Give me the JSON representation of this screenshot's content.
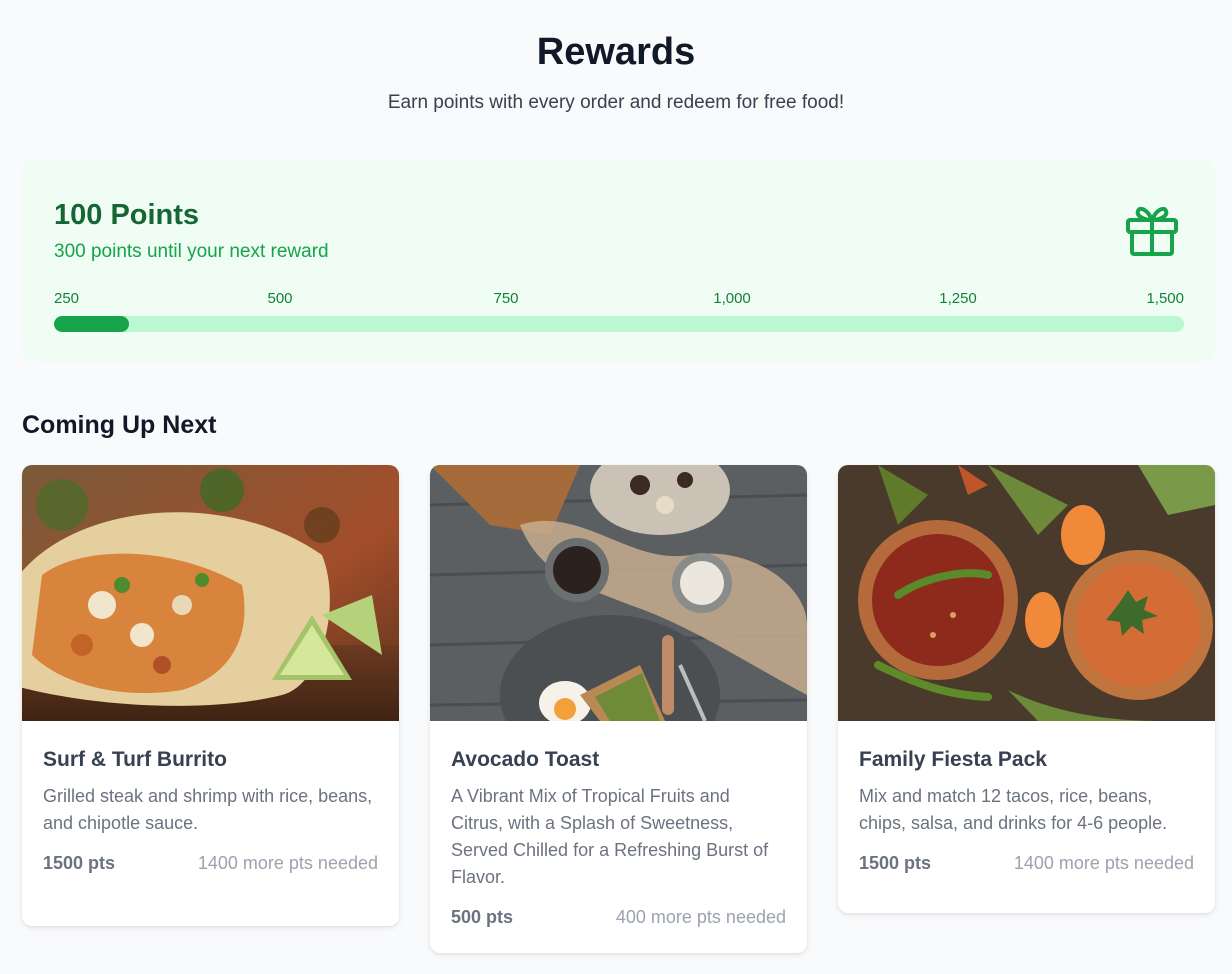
{
  "header": {
    "title": "Rewards",
    "subtitle": "Earn points with every order and redeem for free food!"
  },
  "points_card": {
    "points_label": "100 Points",
    "next_reward_text": "300 points until your next reward",
    "icon": "gift-icon",
    "progress_ticks": [
      "250",
      "500",
      "750",
      "1,000",
      "1,250",
      "1,500"
    ],
    "progress_fraction": 0.066
  },
  "section": {
    "title": "Coming Up Next"
  },
  "rewards": [
    {
      "title": "Surf & Turf Burrito",
      "description": "Grilled steak and shrimp with rice, beans, and chipotle sauce.",
      "points": "1500 pts",
      "needed": "1400 more pts needed",
      "image": "burrito-photo"
    },
    {
      "title": "Avocado Toast",
      "description": "A Vibrant Mix of Tropical Fruits and Citrus, with a Splash of Sweetness, Served Chilled for a Refreshing Burst of Flavor.",
      "points": "500 pts",
      "needed": "400 more pts needed",
      "image": "avocado-toast-photo"
    },
    {
      "title": "Family Fiesta Pack",
      "description": "Mix and match 12 tacos, rice, beans, chips, salsa, and drinks for 4-6 people.",
      "points": "1500 pts",
      "needed": "1400 more pts needed",
      "image": "salsa-bowls-photo"
    }
  ],
  "colors": {
    "brand_green": "#16a34a",
    "card_bg": "#f0fdf4",
    "track": "#bbf7d0"
  }
}
